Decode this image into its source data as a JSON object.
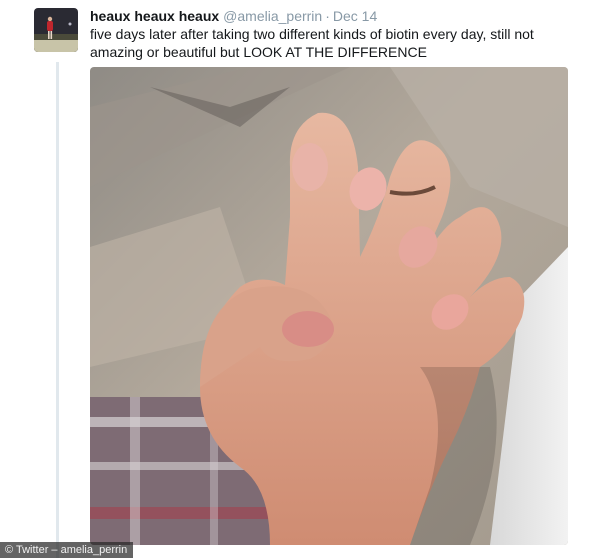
{
  "tweet": {
    "display_name": "heaux heaux heaux",
    "handle": "@amelia_perrin",
    "separator": "·",
    "date": "Dec 14",
    "text": "five days later after taking two different kinds of biotin every day, still not amazing or beautiful but LOOK AT THE DIFFERENCE"
  },
  "media": {
    "alt": "photo of a hand with natural fingernails"
  },
  "credit": "© Twitter – amelia_perrin",
  "colors": {
    "name": "#14171a",
    "meta": "#8899a6",
    "thread_line": "#e1e8ed"
  },
  "icons": {
    "avatar": "profile-photo"
  }
}
